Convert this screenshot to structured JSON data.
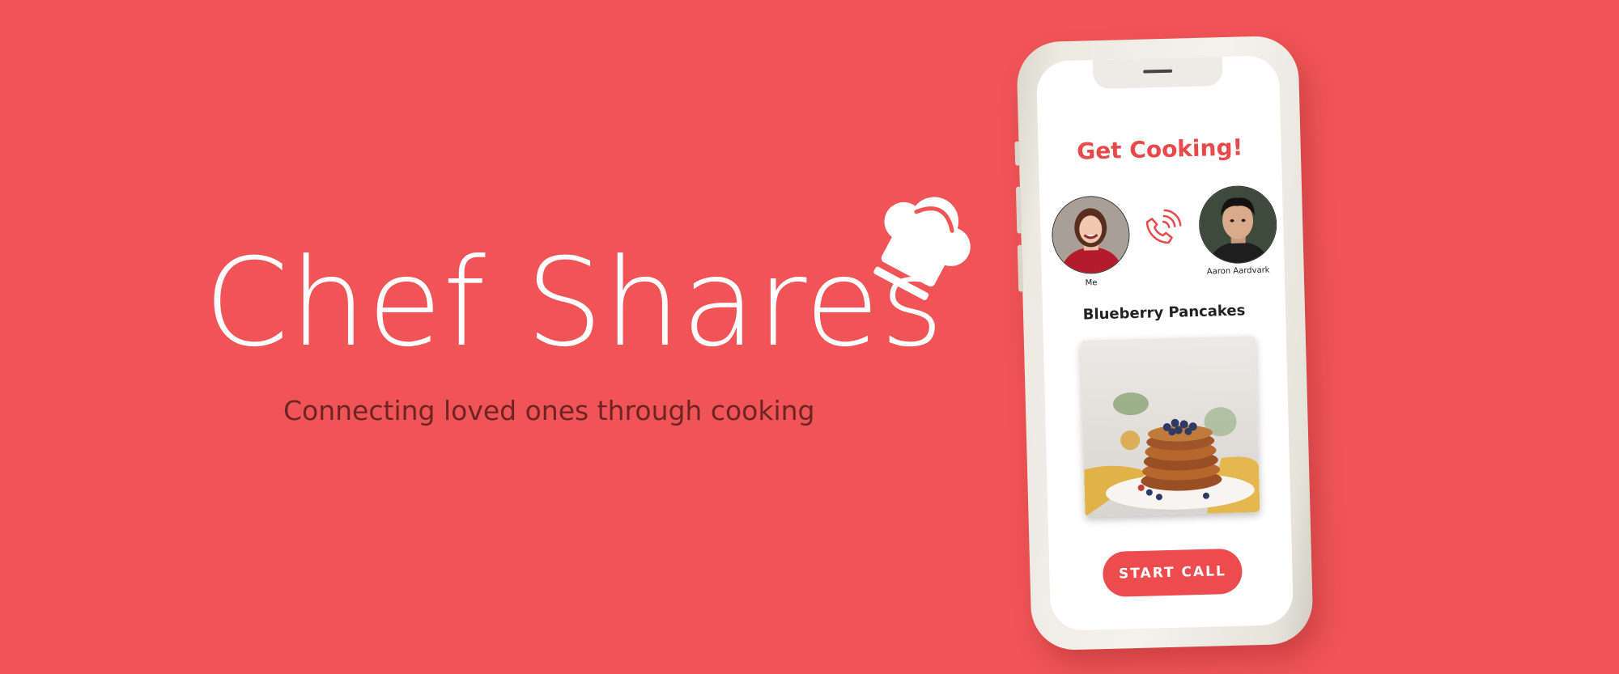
{
  "brand": {
    "title": "Chef Shares",
    "tagline": "Connecting loved ones through cooking",
    "logo_icon": "chef-hat-icon"
  },
  "app": {
    "heading": "Get Cooking!",
    "participants": [
      {
        "name": "Me"
      },
      {
        "name": "Aaron Aardvark"
      }
    ],
    "call_icon": "phone-ringing-icon",
    "recipe_name": "Blueberry Pancakes",
    "start_call_label": "START CALL"
  },
  "colors": {
    "background": "#F05456",
    "accent": "#E8494B",
    "tagline": "#6E2424",
    "phone_body": "#F4F2EC"
  }
}
